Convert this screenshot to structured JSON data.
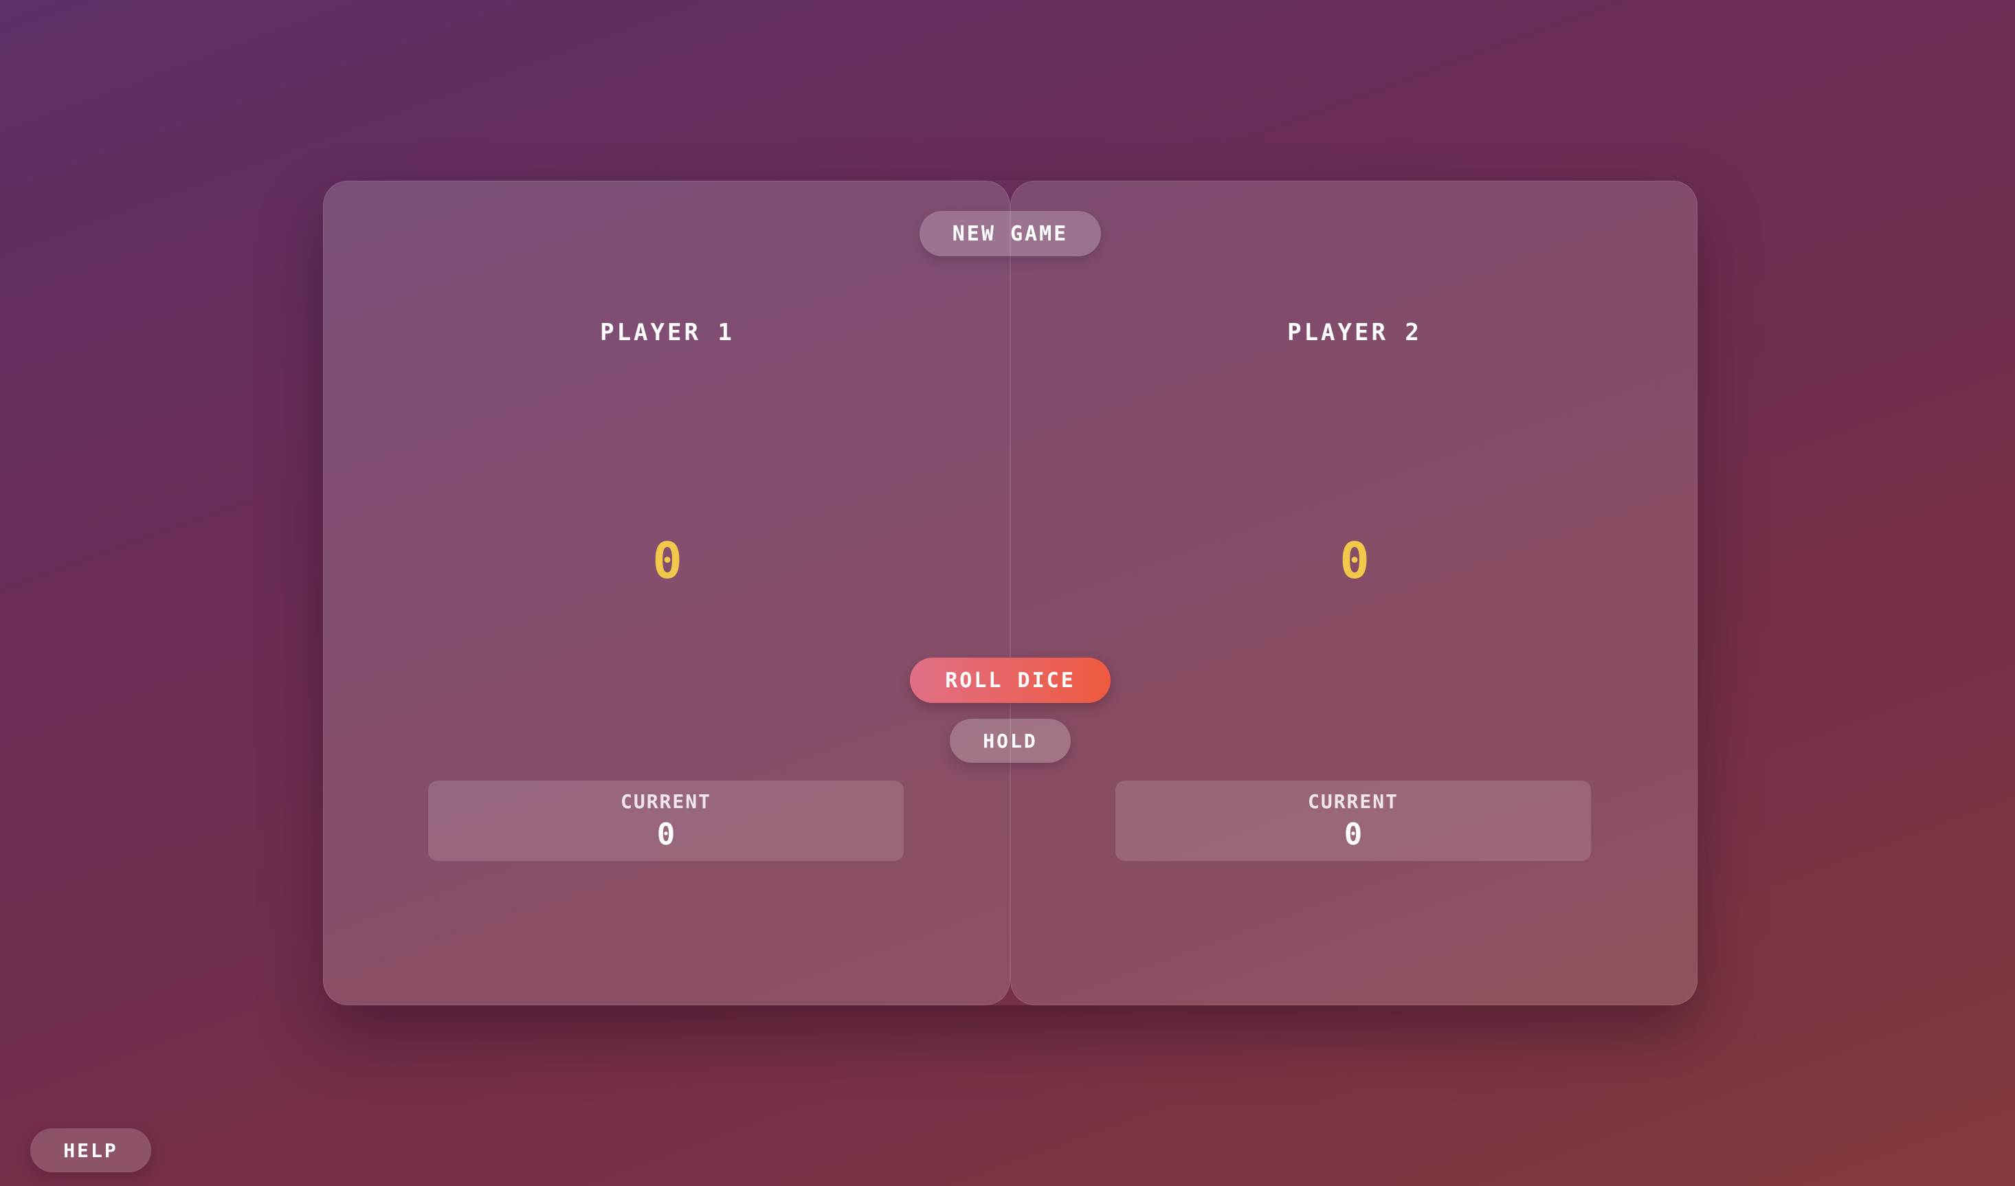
{
  "buttons": {
    "new_game": "NEW GAME",
    "roll_dice": "ROLL DICE",
    "hold": "HOLD",
    "help": "HELP"
  },
  "players": [
    {
      "name": "PLAYER 1",
      "score": "0",
      "current_label": "CURRENT",
      "current_score": "0"
    },
    {
      "name": "PLAYER 2",
      "score": "0",
      "current_label": "CURRENT",
      "current_score": "0"
    }
  ],
  "colors": {
    "score": "#f2c84b",
    "roll_button_start": "#e06f86",
    "roll_button_end": "#ef5a40"
  }
}
